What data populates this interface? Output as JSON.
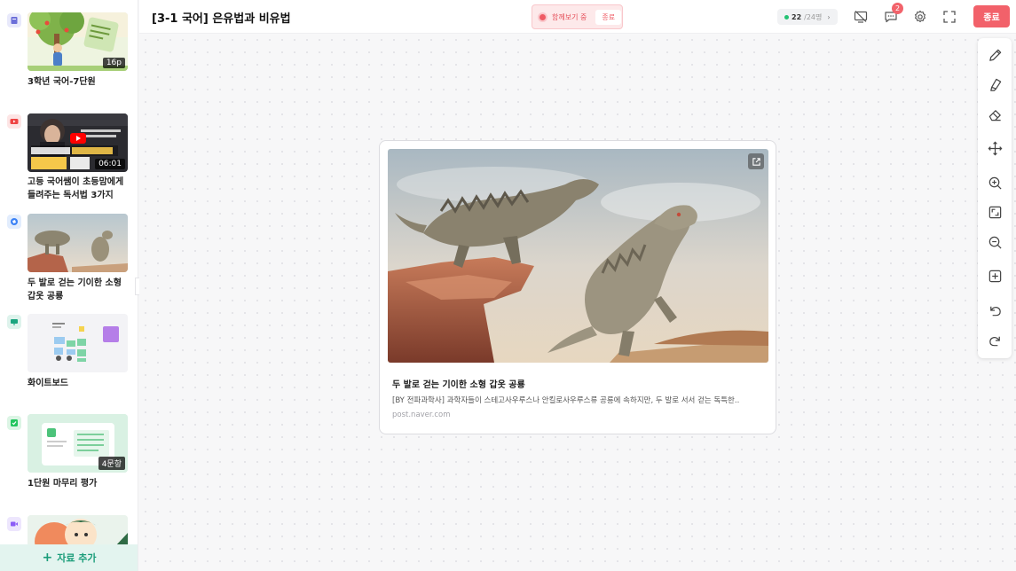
{
  "sidebar": {
    "items": [
      {
        "title": "3학년 국어-7단원",
        "badge": "16p",
        "type_icon": "book-icon",
        "type_color": "#6c6fd9",
        "type_bg": "#e8e9fb"
      },
      {
        "title": "고등 국어쌤이 초등맘에게 들려주는 독서법 3가지",
        "badge": "06:01",
        "type_icon": "youtube-icon",
        "type_color": "#ef4444",
        "type_bg": "#fde5e5"
      },
      {
        "title": "두 발로 걷는 기이한 소형 갑옷 공룡",
        "badge": "",
        "type_icon": "web-icon",
        "type_color": "#3b82f6",
        "type_bg": "#e2edfd"
      },
      {
        "title": "화이트보드",
        "badge": "",
        "type_icon": "whiteboard-icon",
        "type_color": "#1ba57f",
        "type_bg": "#def3ec"
      },
      {
        "title": "1단원 마무리 평가",
        "badge": "4문항",
        "type_icon": "quiz-icon",
        "type_color": "#22c55e",
        "type_bg": "#dcf5e5"
      },
      {
        "title": "",
        "badge": "",
        "type_icon": "video-icon",
        "type_color": "#8b5cf6",
        "type_bg": "#ede6fd"
      }
    ],
    "add_label": "자료 추가"
  },
  "header": {
    "title": "[3-1 국어] 은유법과 비유법",
    "watch_label": "함께보기 중",
    "watch_end_label": "종료",
    "participants_current": "22",
    "participants_total": "/24명",
    "chat_badge": "2",
    "end_label": "종료"
  },
  "card": {
    "title": "두 발로 걷는 기이한 소형 갑옷 공룡",
    "description": "[BY 전파과학사] 과학자들이 스테고사우루스나 안킬로사우루스류 공룡에 속하지만, 두 발로 서서 걷는 독특한..",
    "source": "post.naver.com"
  },
  "toolbar": {
    "tools": [
      "pen-icon",
      "highlighter-icon",
      "eraser-icon",
      "move-icon",
      "zoom-in-icon",
      "fit-screen-icon",
      "zoom-out-icon",
      "add-box-icon",
      "undo-icon",
      "redo-icon"
    ]
  },
  "colors": {
    "accent": "#f2616a",
    "add_bar": "#1b9d7a",
    "online_dot": "#23c273"
  }
}
